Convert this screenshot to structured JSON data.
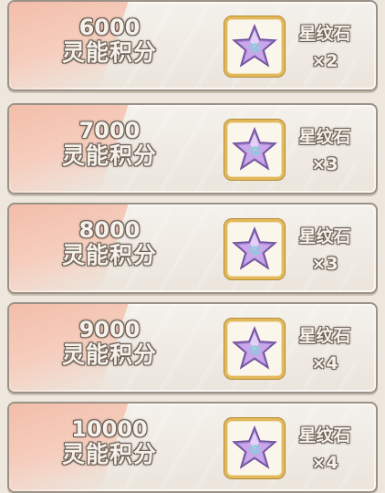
{
  "rewards": [
    {
      "score": "6000",
      "score_label": "灵能积分",
      "item_name": "星纹石",
      "item_count": "×2",
      "item_icon": "star-crystal-icon"
    },
    {
      "score": "7000",
      "score_label": "灵能积分",
      "item_name": "星纹石",
      "item_count": "×3",
      "item_icon": "star-crystal-icon"
    },
    {
      "score": "8000",
      "score_label": "灵能积分",
      "item_name": "星纹石",
      "item_count": "×3",
      "item_icon": "star-crystal-icon"
    },
    {
      "score": "9000",
      "score_label": "灵能积分",
      "item_name": "星纹石",
      "item_count": "×4",
      "item_icon": "star-crystal-icon"
    },
    {
      "score": "10000",
      "score_label": "灵能积分",
      "item_name": "星纹石",
      "item_count": "×4",
      "item_icon": "star-crystal-icon"
    }
  ],
  "colors": {
    "card_bg": "#f0ebe3",
    "card_border": "#9b9186",
    "stripe": "#f4c4b1",
    "slot_border": "#e2b95a",
    "star_fill": "#c9a8ea",
    "star_dark": "#9b7ac8",
    "star_swirl": "#7fd3d8"
  }
}
